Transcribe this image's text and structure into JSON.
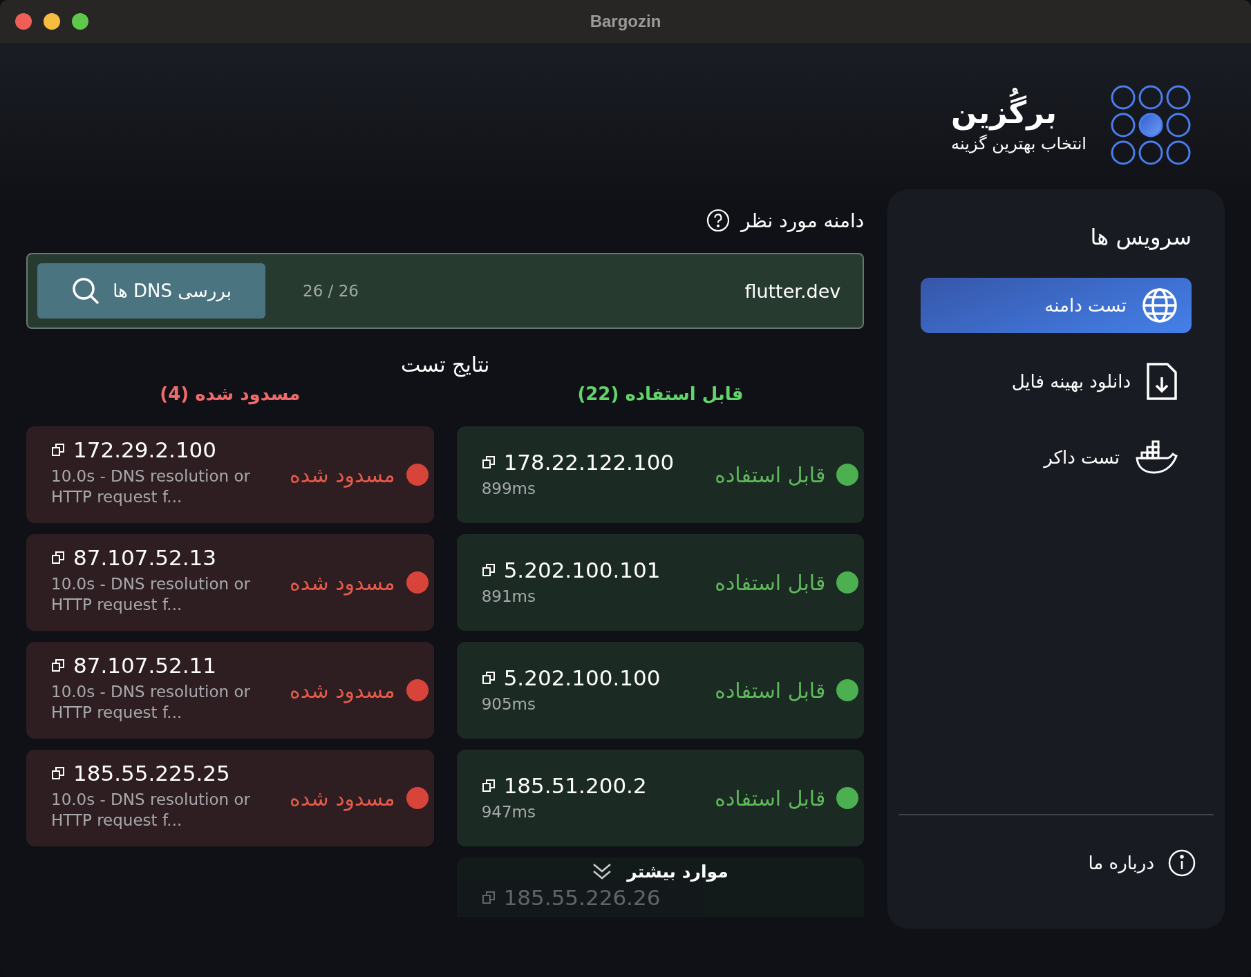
{
  "window": {
    "title": "Bargozin"
  },
  "brand": {
    "name": "برگُزین",
    "tagline": "انتخاب بهترین گزینه"
  },
  "sidebar": {
    "title": "سرویس ها",
    "items": [
      {
        "label": "تست دامنه",
        "selected": true
      },
      {
        "label": "دانلود بهینه فایل",
        "selected": false
      },
      {
        "label": "تست داکر",
        "selected": false
      }
    ],
    "footer": {
      "label": "درباره ما"
    }
  },
  "domain": {
    "label": "دامنه مورد نظر",
    "value": "flutter.dev",
    "counter": "26 / 26",
    "button": "بررسی DNS ها"
  },
  "results": {
    "title": "نتایج تست",
    "groups": [
      {
        "kind": "ok",
        "heading": "قابل استفاده (22)",
        "items": [
          {
            "ip": "178.22.122.100",
            "status": "قابل استفاده",
            "detail": "899ms"
          },
          {
            "ip": "5.202.100.101",
            "status": "قابل استفاده",
            "detail": "891ms"
          },
          {
            "ip": "5.202.100.100",
            "status": "قابل استفاده",
            "detail": "905ms"
          },
          {
            "ip": "185.51.200.2",
            "status": "قابل استفاده",
            "detail": "947ms"
          },
          {
            "ip": "185.55.226.26",
            "faded": true
          }
        ],
        "more": {
          "label": "موارد بیشتر"
        }
      },
      {
        "kind": "blocked",
        "heading": "مسدود شده (4)",
        "items": [
          {
            "ip": "172.29.2.100",
            "status": "مسدود شده",
            "detail": "10.0s - DNS resolution or HTTP request f..."
          },
          {
            "ip": "87.107.52.13",
            "status": "مسدود شده",
            "detail": "10.0s - DNS resolution or HTTP request f..."
          },
          {
            "ip": "87.107.52.11",
            "status": "مسدود شده",
            "detail": "10.0s - DNS resolution or HTTP request f..."
          },
          {
            "ip": "185.55.225.25",
            "status": "مسدود شده",
            "detail": "10.0s - DNS resolution or HTTP request f..."
          }
        ]
      }
    ]
  }
}
